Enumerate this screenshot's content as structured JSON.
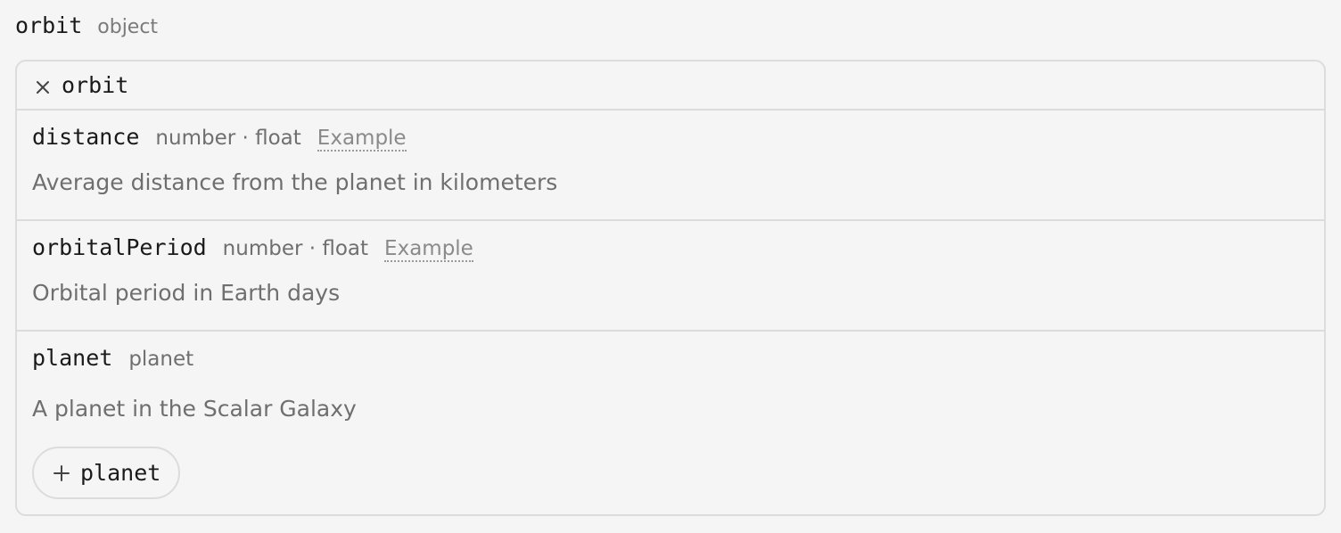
{
  "header": {
    "name": "orbit",
    "type": "object"
  },
  "panel": {
    "collapse_label": "orbit",
    "collapse_icon": "close-icon",
    "properties": [
      {
        "name": "distance",
        "type": "number · float",
        "example_label": "Example",
        "description": "Average distance from the planet in kilometers"
      },
      {
        "name": "orbitalPeriod",
        "type": "number · float",
        "example_label": "Example",
        "description": "Orbital period in Earth days"
      },
      {
        "name": "planet",
        "type": "planet",
        "description": "A planet in the Scalar Galaxy",
        "expand_button_label": "planet",
        "expand_icon": "plus-icon"
      }
    ]
  },
  "colors": {
    "background": "#f5f5f5",
    "border": "#dcdcdc",
    "text_primary": "#1a1a1a",
    "text_muted": "#6f6f6f"
  }
}
